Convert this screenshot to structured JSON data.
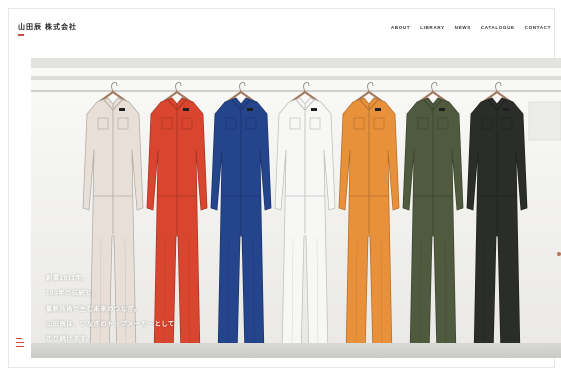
{
  "header": {
    "logo_text": "山田辰 株式会社",
    "accent_color": "#d04a3a",
    "nav": [
      {
        "label": "ABOUT"
      },
      {
        "label": "LIBRARY"
      },
      {
        "label": "NEWS"
      },
      {
        "label": "CATALOGUE"
      },
      {
        "label": "CONTACT"
      }
    ]
  },
  "hero": {
    "tagline_lines": [
      "創業1911年。",
      "100年の伝統と、",
      "最新技術が生む未来のつなぎ。",
      "山田辰は、つなぎのトップメーカーとして",
      "走り続けます。"
    ],
    "coverall_colors": [
      "#e7dfd8",
      "#d9452f",
      "#24448c",
      "#f7f7f6",
      "#e9913a",
      "#4f5a3e",
      "#2a2d2a"
    ]
  },
  "icons": {
    "menu": "menu-icon",
    "prev": "chevron-left-icon",
    "next": "chevron-right-icon"
  }
}
